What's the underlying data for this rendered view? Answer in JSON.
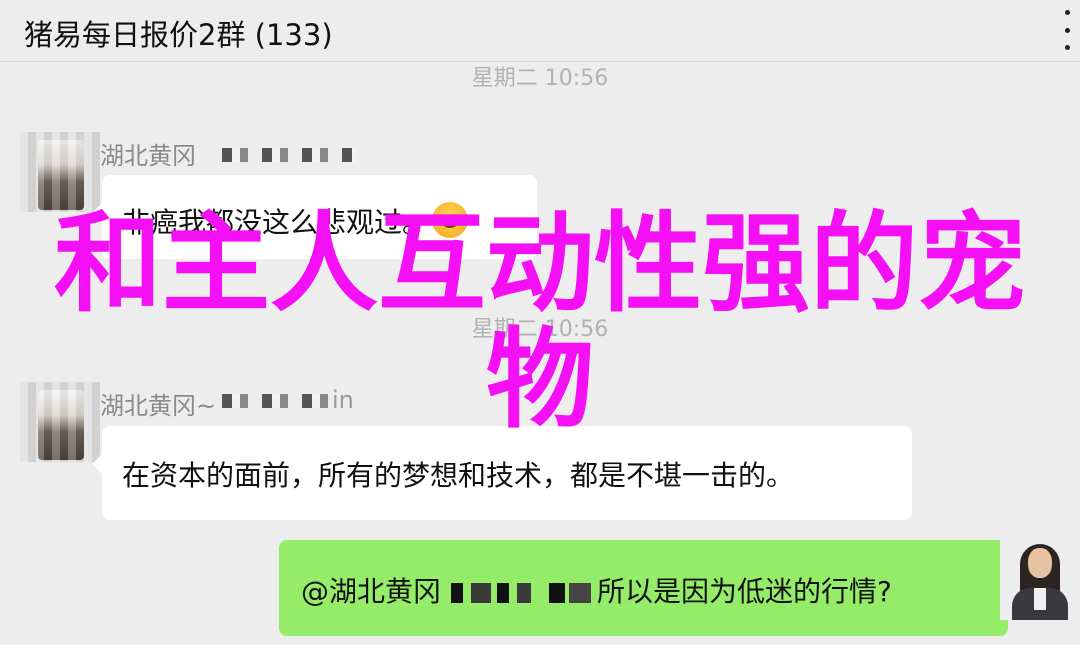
{
  "header": {
    "title": "猪易每日报价2群 (133)"
  },
  "messages": [
    {
      "timestamp": "星期二 10:56",
      "sender": "湖北黄冈",
      "text": "非癌我都没这么悲观过。",
      "emoji": "crying-laughing-emoji"
    },
    {
      "timestamp": "星期二 10:56",
      "sender": "湖北黄冈~",
      "sender_suffix": "in",
      "text": "在资本的面前，所有的梦想和技术，都是不堪一击的。"
    },
    {
      "self": true,
      "mention": "@湖北黄冈",
      "text": "所以是因为低迷的行情?"
    }
  ],
  "overlay": {
    "text": "和主人互动性强的宠物",
    "color": "#f50ff5"
  },
  "colors": {
    "background": "#ededed",
    "self_bubble": "#95ec69",
    "other_bubble": "#ffffff"
  }
}
